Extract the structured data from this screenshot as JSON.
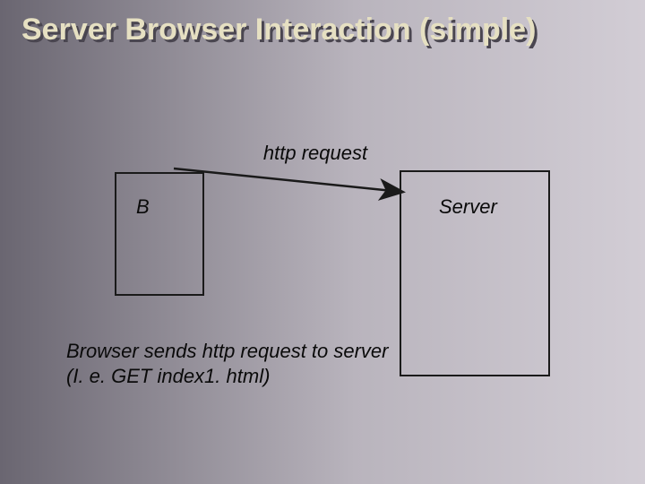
{
  "title": "Server Browser Interaction (simple)",
  "httpLabel": "http request",
  "browserLabel": "B",
  "serverLabel": "Server",
  "captionLine1": "Browser sends http request to server",
  "captionLine2": "(I. e. GET index1. html)"
}
